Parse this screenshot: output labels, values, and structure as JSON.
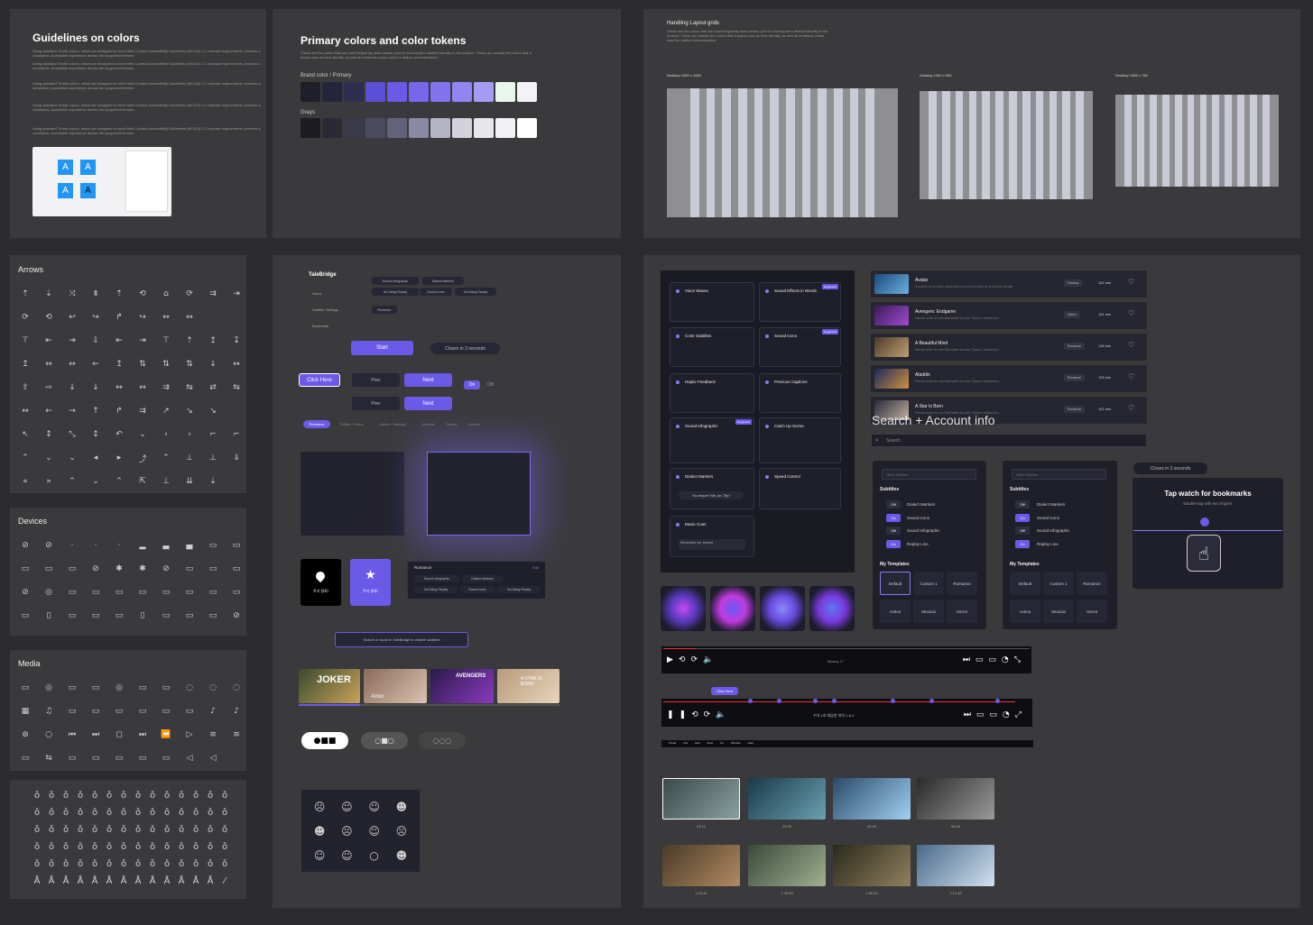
{
  "colors": {
    "bg": "#2c2c2e",
    "panel": "#3a3a3c",
    "accent": "#6b5ae8",
    "dark": "#1f1f29"
  },
  "guidelines": {
    "title": "Guidelines on colors",
    "body": "Using standard Tmotiv colors, which are designed to meet Web Content Accessibility Guidelines (WCAG) 2.1 contrast requirements, ensures a consistent, accessible experience across the supported themes.",
    "sample": [
      "A",
      "A",
      "A",
      "A"
    ]
  },
  "primary": {
    "title": "Primary colors and color tokens",
    "desc": "These are the colors that are most frequently used across your UI and impart a distinct identity to the product. These are usually the colors that a brand uses as their identity, as well as feedback colors used for status communication.",
    "brand_label": "Brand color / Primary",
    "grays_label": "Grays",
    "brand": [
      "#1f1f2a",
      "#24243a",
      "#2e2e50",
      "#5b4fd6",
      "#6b5ae8",
      "#7566ec",
      "#8373ee",
      "#9385f1",
      "#a69bf4",
      "#e8f7e9",
      "#f2f2f7"
    ],
    "grays": [
      "#1c1c22",
      "#2a2a36",
      "#3a3a4a",
      "#4b4b5e",
      "#62627a",
      "#8a8aa2",
      "#b4b4c4",
      "#d2d2dc",
      "#e6e6ec",
      "#f2f2f6",
      "#ffffff"
    ]
  },
  "layout": {
    "title": "Handling Layout grids",
    "labels": [
      "Desktop 1920 x 1080",
      "Desktop 1440 x 900",
      "Desktop 1366 x 768"
    ]
  },
  "icons": {
    "arrows_title": "Arrows",
    "devices_title": "Devices",
    "media_title": "Media",
    "arrow_rows": [
      "⇡⇣⤨⇟⇡⟲⌂⟳⇉⇥",
      "⟳⟲↩↪↱↪↔↔",
      "⊤⇤⇥⇩⇤⇥⊤⇡↥↧",
      "↥↔↔←↥⇅⇅⇅↓↔",
      "⇧⇨↓↓↔↔⇉⇆⇄⇆",
      "↔←→↑↱⇉↗↘↘",
      "↖↕⤡↕↶⌄‹›⌐⌐",
      "⌃⌄⌄◂▸⤴⌃⊥⊥⇓",
      "«»⌃⌄⌃⇱⊥⇊⇣"
    ],
    "device_rows": [
      "⊘⊘···▂▃▄▭▭",
      "▭▭▭⊘✱✱⊘▭▭▭",
      "⊘◎▭▭▭▭▭▭▭▭",
      "▭▯▭▭▭▯▭▭▭⊘"
    ],
    "media_rows": [
      "▭◎▭▭◎▭▭◌◌◌",
      "▦♫▭▭▭▭▭▭♪♪",
      "⊛○⏮⏭◻⏭⏪▷≡≡",
      "▭⇆▭▭▭▭▭◁◁"
    ]
  },
  "gestures": {
    "rows": [
      "ǒǒǒǒǒǒǒǒǒǒǒǒǒǒ",
      "ǒǒǒǒǒǒǒǒǒǒǒǒǒǒ",
      "ǒǒǒǒǒǒǒǒǒǒǒǒǒǒ",
      "ǒǒǒǒǒǒǒǒǒǒǒǒǒǒ",
      "ǒǒǒǒǒǒǒǒǒǒǒǒǒǒ",
      "ÅÅÅÅÅÅÅÅÅÅÅÅÅ⁄"
    ]
  },
  "components": {
    "logo": "TaleBridge",
    "nav": [
      "Home",
      "Subtitle Settings",
      "Bookmark"
    ],
    "chips": [
      "Sound Infographic",
      "Dialect Markers",
      "3s Dialog Replay",
      "Sound Icons",
      "3s Dialog Replay"
    ],
    "romance_chip": "Romance",
    "start": "Start",
    "closes": "Closes in 3 seconds",
    "click_here": "Click Here",
    "prev": "Prev",
    "next": "Next",
    "on": "On",
    "off": "Off",
    "genres": [
      "Romance",
      "Thriller / Horror",
      "Action / Fantasy",
      "Musical",
      "Drama",
      "Custom"
    ],
    "save_label": "주기 완료!",
    "card_title": "Romance",
    "edit": "Edit",
    "card_chips": [
      "Sound Infographic",
      "Dialect Markers",
      "3s Dialog Replay",
      "Sound Icons",
      "3s Dialog Replay"
    ],
    "search_tip": "Search a movie in TaleBridge to enable subtitles",
    "posters": [
      "JOKER",
      "Amor",
      "AVENGERS",
      "A STAR IS BORN"
    ]
  },
  "features": {
    "items": [
      "Voice Waves",
      "Sound Effects in Words",
      "Color Subtitles",
      "Sound Icons",
      "Haptic Feedback",
      "Previous Captions",
      "Sound Infographic",
      "Catch Up Scene",
      "Dialect Markers",
      "Speed Control",
      "Music Cues"
    ],
    "new": "Suggested",
    "dialect_quote": "You rescue? Kith, jar, Tilly?",
    "music_note": "Remember me, forever"
  },
  "movies": {
    "rows": [
      {
        "title": "Avatar",
        "genre": "Fantasy",
        "dur": "162 min"
      },
      {
        "title": "Avengers: Endgame",
        "genre": "Action",
        "dur": "181 min"
      },
      {
        "title": "A Beautiful Mind",
        "genre": "Romance",
        "dur": "135 min"
      },
      {
        "title": "Aladdin",
        "genre": "Romance",
        "dur": "128 min"
      },
      {
        "title": "A Star Is Born",
        "genre": "Romance",
        "dur": "102 min"
      }
    ],
    "desc": "A marine on an alien planet falls in love and fights to protect its people.",
    "desc2": "Heroes unite for one final battle to undo Thanos' destruction."
  },
  "search": {
    "title": "Search + Account info",
    "placeholder": "Search"
  },
  "settings": {
    "search_ph": "Other Movies",
    "subtitles_label": "Subtitles",
    "toggles": [
      {
        "state": "Off",
        "label": "Dialect Markers"
      },
      {
        "state": "On",
        "label": "Sound Icons"
      },
      {
        "state": "Off",
        "label": "Sound Infographic"
      },
      {
        "state": "On",
        "label": "Replay Line"
      }
    ],
    "toggles2": [
      {
        "state": "Off",
        "label": "Dialect Markers"
      },
      {
        "state": "On",
        "label": "Sound Icons"
      },
      {
        "state": "Off",
        "label": "Sound Infographic"
      },
      {
        "state": "On",
        "label": "Replay Line"
      }
    ],
    "templates_label": "My Templates",
    "templates": [
      "Default",
      "Custom 1",
      "Romance",
      "Action",
      "Musical",
      "Horror"
    ]
  },
  "bookmark": {
    "closes": "Closes in 3 seconds",
    "title": "Tap watch for bookmarks",
    "sub": "Double-tap with two fingers"
  },
  "player": {
    "title": "Mickey 17",
    "click": "Click Here",
    "subtitle_text": "수치 1호 대답한 의미 1 & 2",
    "menu": [
      "Finder",
      "File",
      "Edit",
      "View",
      "Go",
      "Window",
      "Help"
    ]
  },
  "thumbs": {
    "times": [
      "23:12",
      "29:38",
      "41:40",
      "53:46",
      "1:33:44",
      "1:45:53",
      "1:59:42",
      "2:12:48"
    ]
  }
}
